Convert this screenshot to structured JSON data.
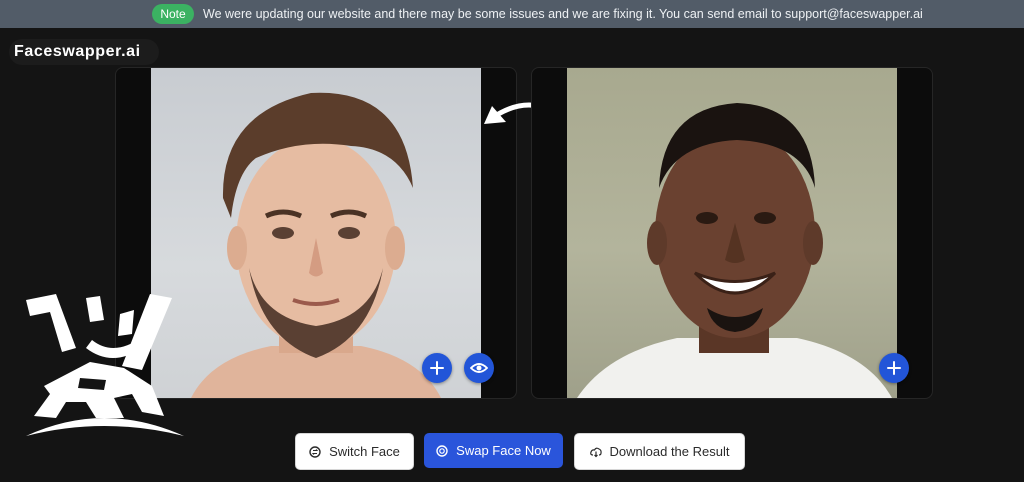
{
  "notice": {
    "badge": "Note",
    "text": "We were updating our website and there may be some issues and we are fixing it. You can send email to support@faceswapper.ai",
    "badge_color": "#3bb262"
  },
  "brand": {
    "logo_text": "Faceswapper.ai"
  },
  "panels": {
    "source": {
      "add_icon": "plus-icon",
      "preview_icon": "eye-icon"
    },
    "target": {
      "add_icon": "plus-icon"
    },
    "swap_direction_icon": "curved-arrow-left-icon"
  },
  "actions": {
    "switch_face": "Switch Face",
    "swap_face_now": "Swap Face Now",
    "download_result": "Download the Result"
  },
  "colors": {
    "accent": "#2a55db",
    "background": "#141414",
    "notice_bar": "#525c68"
  }
}
